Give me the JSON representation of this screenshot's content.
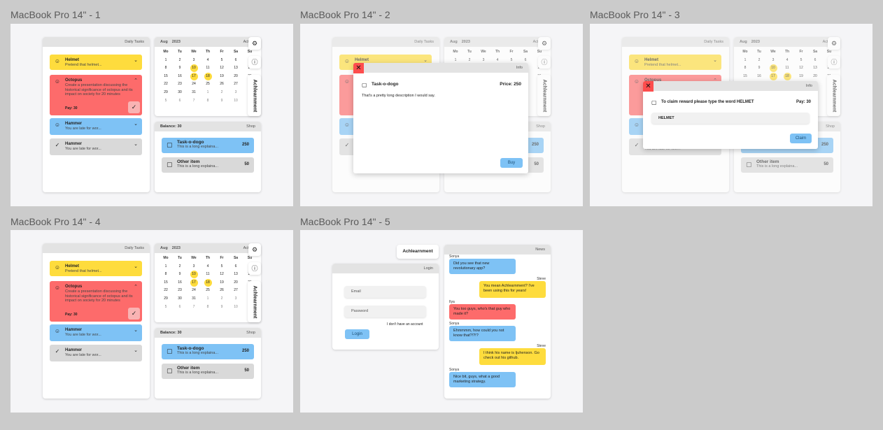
{
  "frames": [
    "MacBook Pro 14\" - 1",
    "MacBook Pro 14\" - 2",
    "MacBook Pro 14\" - 3",
    "MacBook Pro 14\" - 4",
    "MacBook Pro 14\" - 5"
  ],
  "tasks": {
    "header": "Daily Tasks",
    "items": [
      {
        "title": "Helmet",
        "desc": "Pretend that helmet..."
      },
      {
        "title": "Octopus",
        "desc": "Create a presentation discussing the historical significance of octopus and its impact on society for 20 minutes",
        "pay": "Pay: 30"
      },
      {
        "title": "Hammer",
        "desc": "You are late for wor..."
      },
      {
        "title": "Hammer",
        "desc": "You are late for wor..."
      }
    ]
  },
  "calendar": {
    "month": "Aug",
    "year": "2023",
    "label": "Activity",
    "days": [
      "Mo",
      "Tu",
      "We",
      "Th",
      "Fr",
      "Sa",
      "Su"
    ],
    "dates": [
      "1",
      "2",
      "3",
      "4",
      "5",
      "6",
      "7",
      "8",
      "9",
      "10",
      "11",
      "12",
      "13",
      "14",
      "15",
      "16",
      "17",
      "18",
      "19",
      "20",
      "21",
      "22",
      "23",
      "24",
      "25",
      "26",
      "27",
      "28",
      "29",
      "30",
      "31",
      "1",
      "2",
      "3",
      "4",
      "5",
      "6",
      "7",
      "8",
      "9",
      "10",
      "11"
    ]
  },
  "achievement": "Achlearnment",
  "shop": {
    "balance": "Balance: 30",
    "label": "Shop",
    "items": [
      {
        "title": "Task-o-dogo",
        "desc": "This is a long explaina...",
        "price": "250"
      },
      {
        "title": "Other item",
        "desc": "This is a long explaina...",
        "price": "50"
      }
    ]
  },
  "modal_item": {
    "header": "Info",
    "title": "Task-o-dogo",
    "price": "Price: 250",
    "desc": "That's a pretty long description I would say.",
    "buy": "Buy"
  },
  "modal_claim": {
    "header": "Info",
    "title": "To claim reward please type the word HELMET",
    "pay": "Pay: 30",
    "value": "HELMET",
    "claim": "Claim"
  },
  "login": {
    "tab": "Achlearnment",
    "header": "Login",
    "email": "Email",
    "password": "Password",
    "noaccount": "I don't have an account",
    "button": "Login"
  },
  "news": {
    "header": "News",
    "messages": [
      {
        "sender": "Sonya",
        "text": "Did you see that new revolutionary app?",
        "side": "left",
        "color": "blue"
      },
      {
        "sender": "Steve",
        "text": "You mean Achlearnment? I've been using this for years!",
        "side": "right",
        "color": "yellow"
      },
      {
        "sender": "Ilya",
        "text": "You too guys, who's that guy who made it?",
        "side": "left",
        "color": "red"
      },
      {
        "sender": "Sonya",
        "text": "Ehmmmm, how could you not know that?!?!?",
        "side": "left",
        "color": "blue"
      },
      {
        "sender": "Steve",
        "text": "I think his name is Ijuhenson. Go check out his github.",
        "side": "right",
        "color": "yellow"
      },
      {
        "sender": "Sonya",
        "text": "Nice bit, guys, what a good marketing strategy.",
        "side": "left",
        "color": "blue"
      }
    ]
  },
  "colors": {
    "yellow": "#fedc3d",
    "red": "#fd6b6b",
    "blue": "#7ec2f5",
    "gray": "#d9d9d9"
  }
}
